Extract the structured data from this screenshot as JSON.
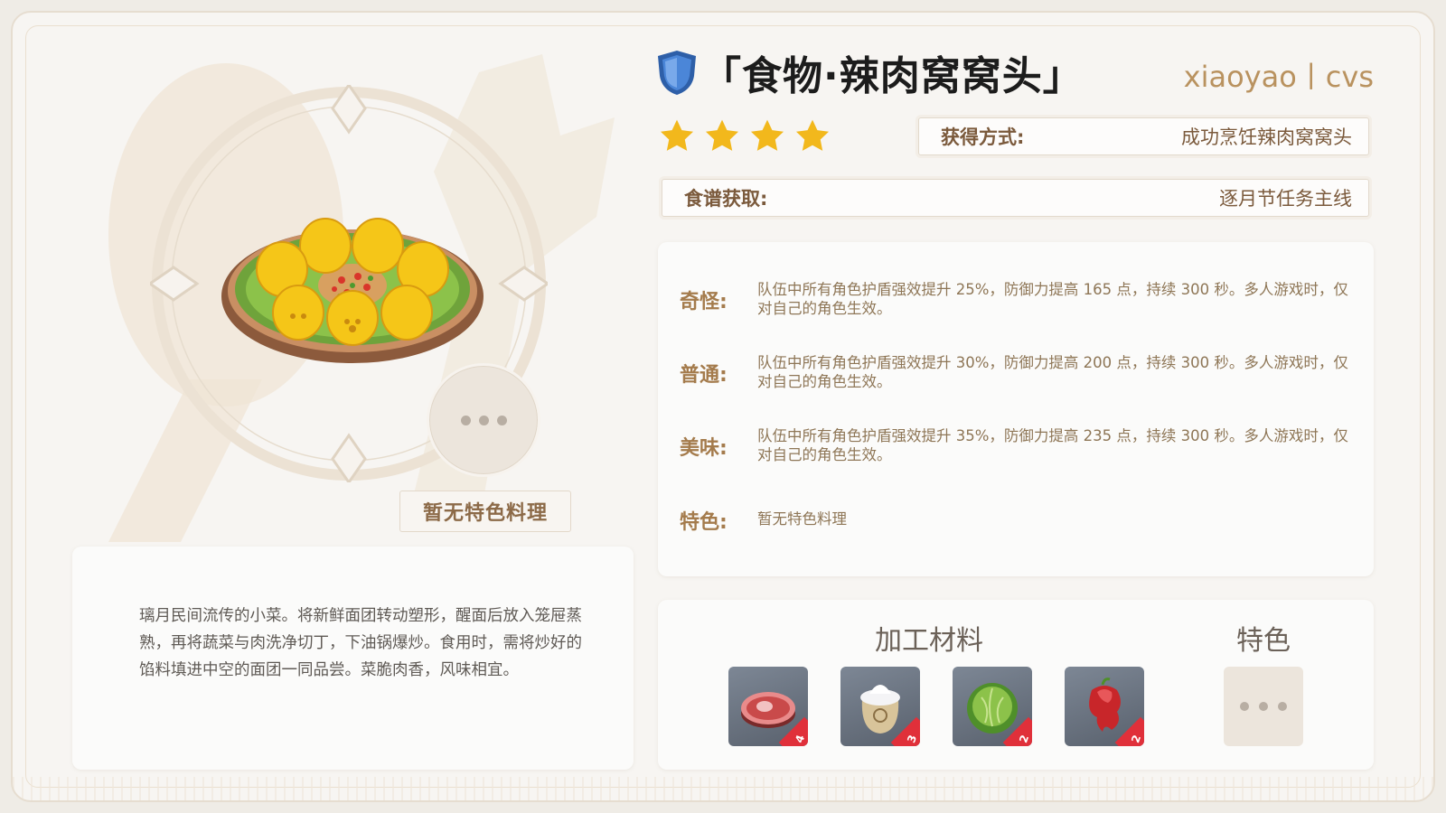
{
  "header": {
    "title": "「食物·辣肉窝窝头」",
    "author": "xiaoyao丨cvs",
    "rarity_stars": 4
  },
  "obtain": {
    "label": "获得方式:",
    "value": "成功烹饪辣肉窝窝头"
  },
  "recipe": {
    "label": "食谱获取:",
    "value": "逐月节任务主线"
  },
  "effects": [
    {
      "label": "奇怪:",
      "text": "队伍中所有角色护盾强效提升 25%，防御力提高 165 点，持续 300 秒。多人游戏时，仅对自己的角色生效。"
    },
    {
      "label": "普通:",
      "text": "队伍中所有角色护盾强效提升 30%，防御力提高 200 点，持续 300 秒。多人游戏时，仅对自己的角色生效。"
    },
    {
      "label": "美味:",
      "text": "队伍中所有角色护盾强效提升 35%，防御力提高 235 点，持续 300 秒。多人游戏时，仅对自己的角色生效。"
    },
    {
      "label": "特色:",
      "text": "暂无特色料理"
    }
  ],
  "special_dish_tag": "暂无特色料理",
  "description": "璃月民间流传的小菜。将新鲜面团转动塑形，醒面后放入笼屉蒸熟，再将蔬菜与肉洗净切丁，下油锅爆炒。食用时，需将炒好的馅料填进中空的面团一同品尝。菜脆肉香，风味相宜。",
  "materials": {
    "heading": "加工材料",
    "special_heading": "特色",
    "items": [
      {
        "icon": "raw-meat-icon",
        "count": "4"
      },
      {
        "icon": "flour-sack-icon",
        "count": "3"
      },
      {
        "icon": "cabbage-icon",
        "count": "2"
      },
      {
        "icon": "jueyun-chili-icon",
        "count": "2"
      }
    ]
  },
  "colors": {
    "accent_brown": "#a47b4c",
    "title_black": "#1c1c1c",
    "author_gold": "#b9925f",
    "star_gold": "#f2b81c",
    "shield_blue": "#4b86d8",
    "count_badge_red": "#e0303a"
  }
}
